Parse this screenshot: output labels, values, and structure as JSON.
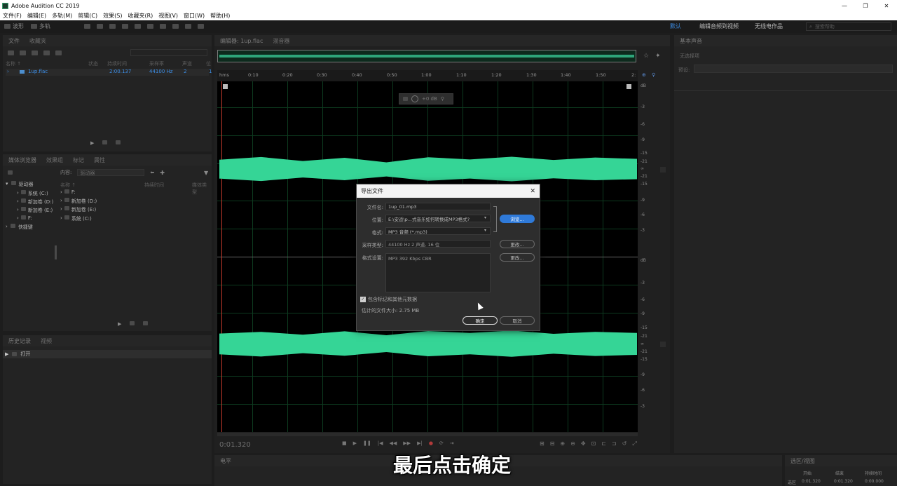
{
  "app": {
    "title": "Adobe Audition CC 2019",
    "minimize": "—",
    "restore": "❐",
    "close": "✕"
  },
  "menu": [
    "文件(F)",
    "编辑(E)",
    "多轨(M)",
    "剪辑(C)",
    "效果(S)",
    "收藏夹(R)",
    "视图(V)",
    "窗口(W)",
    "帮助(H)"
  ],
  "toolbar": {
    "waveform": "波形",
    "multitrack": "多轨"
  },
  "workspaces": [
    "默认",
    "编辑音频到视频",
    "无线电作品"
  ],
  "search_placeholder": "搜索帮助",
  "files_panel": {
    "tabs": [
      "文件",
      "收藏夹"
    ],
    "columns": [
      "名称 ↑",
      "状态",
      "持续时间",
      "采样率",
      "声道",
      "位"
    ],
    "file": {
      "name": "1up.flac",
      "duration": "2:00.137",
      "rate": "44100 Hz",
      "channels": "2",
      "bits": "1"
    }
  },
  "browser": {
    "tabs": [
      "媒体浏览器",
      "效果组",
      "标记",
      "属性"
    ],
    "content_label": "内容:",
    "content_value": "驱动器",
    "tree": [
      "驱动器",
      "系统 (C:)",
      "新加卷 (D:)",
      "新加卷 (E:)",
      "F:",
      "快捷键"
    ],
    "columns": [
      "名称 ↑",
      "持续时间",
      "媒体类型"
    ],
    "list": [
      "F:",
      "新加卷 (D:)",
      "新加卷 (E:)",
      "系统 (C:)"
    ]
  },
  "history": {
    "tabs": [
      "历史记录",
      "视频"
    ],
    "item": "打开"
  },
  "editor": {
    "tabs": [
      "编辑器: 1up.flac",
      "混音器"
    ],
    "timeline": [
      "hms",
      "0:10",
      "0:20",
      "0:30",
      "0:40",
      "0:50",
      "1:00",
      "1:10",
      "1:20",
      "1:30",
      "1:40",
      "1:50",
      "2:"
    ],
    "gain": "+0 dB",
    "time": "0:01.320",
    "db_top": [
      "dB",
      "-3",
      "-6",
      "-9",
      "-15",
      "-21",
      "∞",
      "-21",
      "-15",
      "-9",
      "-6",
      "-3"
    ],
    "db_bottom": [
      "dB",
      "-3",
      "-6",
      "-9",
      "-15",
      "-21",
      "∞",
      "-21",
      "-15",
      "-9",
      "-6",
      "-3"
    ]
  },
  "right_panel": {
    "title": "基本声音",
    "subtitle": "无选择项",
    "preset": "预设:"
  },
  "levels": {
    "title": "电平"
  },
  "selection": {
    "title": "选区/视图",
    "cols": [
      "开始",
      "结束",
      "持续时间"
    ],
    "row_label": "选区",
    "values": [
      "0:01.320",
      "0:01.320",
      "0:00.000"
    ]
  },
  "dialog": {
    "title": "导出文件",
    "close": "✕",
    "filename_label": "文件名:",
    "filename": "1up_01.mp3",
    "location_label": "位置:",
    "location": "E:\\安适\\p...式音乐如何转换成MP3格式?",
    "browse": "浏览...",
    "format_label": "格式:",
    "format": "MP3 音频 (*.mp3)",
    "sample_label": "采样类型:",
    "sample": "44100 Hz 2 声道, 16 位",
    "change": "更改...",
    "format_settings_label": "格式设置:",
    "format_settings": "MP3 392 Kbps CBR",
    "include_markers": "包含标记和其他元数据",
    "estimated_size": "估计的文件大小: 2.75 MB",
    "ok": "确定",
    "cancel": "取消"
  },
  "subtitle": "最后点击确定",
  "colors": {
    "waveform": "#35d596",
    "accent": "#3d8fe8",
    "background": "#1d1d1d"
  }
}
